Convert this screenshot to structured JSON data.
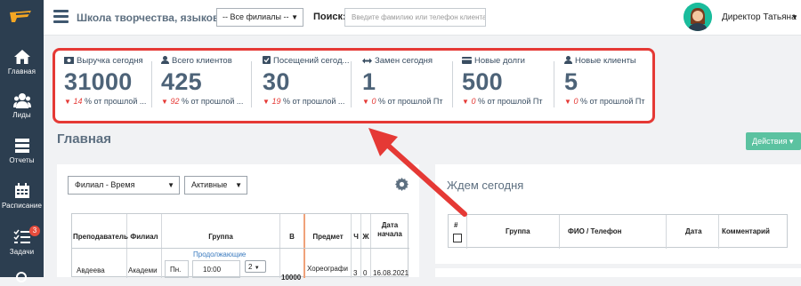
{
  "topbar": {
    "school_name": "Школа творчества, языков, танца",
    "branch_select": "-- Все филиалы --",
    "search_label": "Поиск:",
    "search_placeholder": "Введите фамилию или телефон клиента",
    "user_name": "Директор Татьяна"
  },
  "sidebar": {
    "items": [
      {
        "label": "Главная",
        "icon": "home-icon"
      },
      {
        "label": "Лиды",
        "icon": "users-icon"
      },
      {
        "label": "Отчеты",
        "icon": "reports-icon"
      },
      {
        "label": "Расписание",
        "icon": "calendar-icon"
      },
      {
        "label": "Задачи",
        "icon": "tasks-icon",
        "badge": "3"
      }
    ]
  },
  "stats": [
    {
      "title": "Выручка сегодня",
      "value": "31000",
      "change_pct": "14",
      "change_text": "% от прошлой ..."
    },
    {
      "title": "Всего клиентов",
      "value": "425",
      "change_pct": "92",
      "change_text": "% от прошлой ..."
    },
    {
      "title": "Посещений сегод...",
      "value": "30",
      "change_pct": "19",
      "change_text": "% от прошлой ..."
    },
    {
      "title": "Замен сегодня",
      "value": "1",
      "change_pct": "0",
      "change_text": "% от прошлой Пт"
    },
    {
      "title": "Новые долги",
      "value": "500",
      "change_pct": "0",
      "change_text": "% от прошлой Пт"
    },
    {
      "title": "Новые клиенты",
      "value": "5",
      "change_pct": "0",
      "change_text": "% от прошлой Пт"
    }
  ],
  "main": {
    "page_title": "Главная",
    "actions_label": "Действия ▾"
  },
  "schedule": {
    "filter_sort": "Филиал - Время",
    "filter_status": "Активные",
    "headers": [
      "Преподаватель",
      "Филиал",
      "Группа",
      "В",
      "Предмет",
      "Ч",
      "Ж",
      "Дата начала"
    ],
    "row": {
      "teacher": "Авдеева",
      "branch": "Академи",
      "group_link": "Продолжающие",
      "day": "Пн.",
      "time": "10:00",
      "count": "2",
      "v": "10000",
      "subject": "Хореографи",
      "ch": "3",
      "zh": "0",
      "start_date": "16.08.2021"
    }
  },
  "waiting": {
    "title": "Ждем сегодня",
    "headers": [
      "#",
      "Группа",
      "ФИО / Телефон",
      "Дата",
      "Комментарий"
    ]
  },
  "colors": {
    "sidebar": "#2c3e50",
    "highlight_border": "#e53935",
    "accent_green": "#5bc2a0",
    "stat_value": "#4d6378"
  }
}
